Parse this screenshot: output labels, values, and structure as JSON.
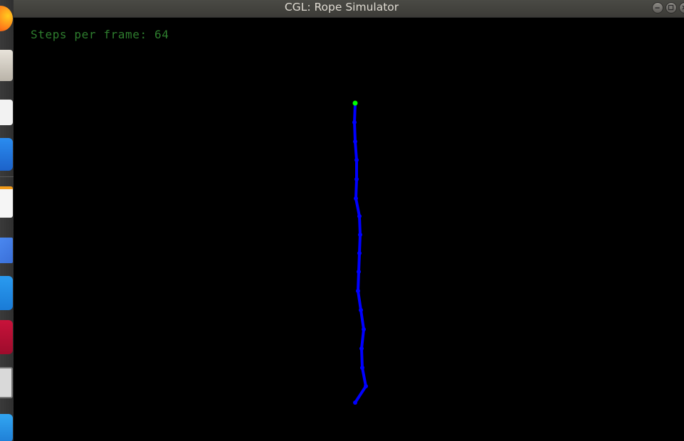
{
  "window": {
    "title": "CGL: Rope Simulator"
  },
  "hud": {
    "steps_text": "Steps per frame: 64"
  },
  "dock": {
    "icons": [
      "firefox-icon",
      "files-app-icon",
      "text-editor-icon",
      "app-store-icon",
      "document-icon",
      "drive-icon",
      "vscode-icon",
      "red-app-icon",
      "screenshot-icon",
      "blue-app-icon"
    ]
  },
  "colors": {
    "rope": "#0000ff",
    "pinned_mass": "#00ff00",
    "hud_text": "#2e7d2e",
    "background": "#000000"
  },
  "rope": {
    "pinned_mass_count": 1,
    "mass_count": 16
  }
}
